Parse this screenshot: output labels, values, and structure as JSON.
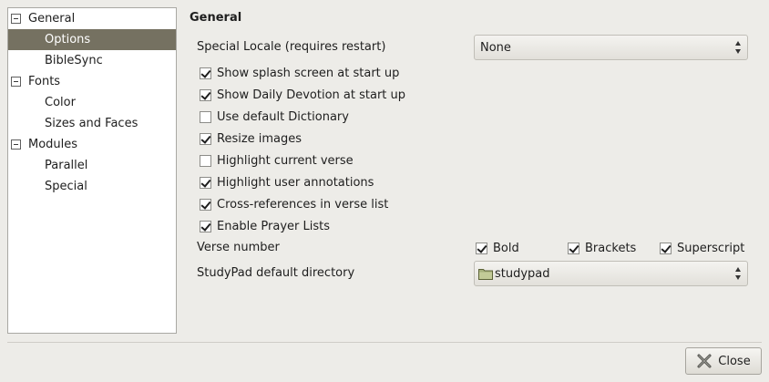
{
  "sidebar": {
    "items": [
      {
        "label": "General",
        "expanded": true
      },
      {
        "label": "Options",
        "selected": true
      },
      {
        "label": "BibleSync"
      },
      {
        "label": "Fonts",
        "expanded": true
      },
      {
        "label": "Color"
      },
      {
        "label": "Sizes and Faces"
      },
      {
        "label": "Modules",
        "expanded": true
      },
      {
        "label": "Parallel"
      },
      {
        "label": "Special"
      }
    ]
  },
  "main": {
    "title": "General",
    "locale": {
      "label": "Special Locale (requires restart)",
      "value": "None"
    },
    "options": [
      {
        "label": "Show splash screen at start up",
        "checked": true
      },
      {
        "label": "Show Daily Devotion at start up",
        "checked": true
      },
      {
        "label": "Use default Dictionary",
        "checked": false
      },
      {
        "label": "Resize images",
        "checked": true
      },
      {
        "label": "Highlight current verse",
        "checked": false
      },
      {
        "label": "Highlight user annotations",
        "checked": true
      },
      {
        "label": "Cross-references in verse list",
        "checked": true
      },
      {
        "label": "Enable Prayer Lists",
        "checked": true
      }
    ],
    "verse_number": {
      "label": "Verse number",
      "bold": "Bold",
      "brackets": "Brackets",
      "superscript": "Superscript"
    },
    "studypad": {
      "label": "StudyPad default directory",
      "value": "studypad"
    }
  },
  "footer": {
    "close_label": "Close"
  }
}
